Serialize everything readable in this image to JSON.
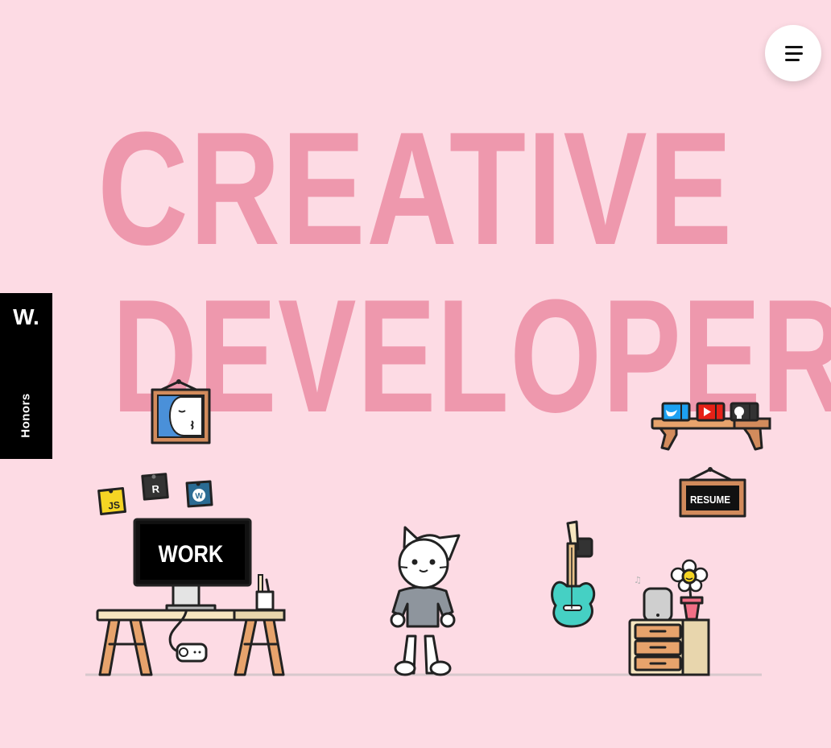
{
  "hero": {
    "line1": "CREATIVE",
    "line2": "DEVELOPER"
  },
  "side_badge": {
    "logo": "W.",
    "label": "Honors"
  },
  "menu": {
    "icon": "hamburger-menu-icon"
  },
  "scene": {
    "monitor_label": "WORK",
    "sign_label": "RESUME",
    "sticky_js": "JS",
    "sticky_r": "R",
    "sticky_wp": "W",
    "music_note": "♫"
  },
  "colors": {
    "background": "#fddbe4",
    "hero_text": "#ee98ad",
    "wood": "#e7a36c",
    "guitar": "#45d0c4",
    "twitter": "#1da1f2",
    "youtube": "#e62117",
    "github": "#333333"
  }
}
